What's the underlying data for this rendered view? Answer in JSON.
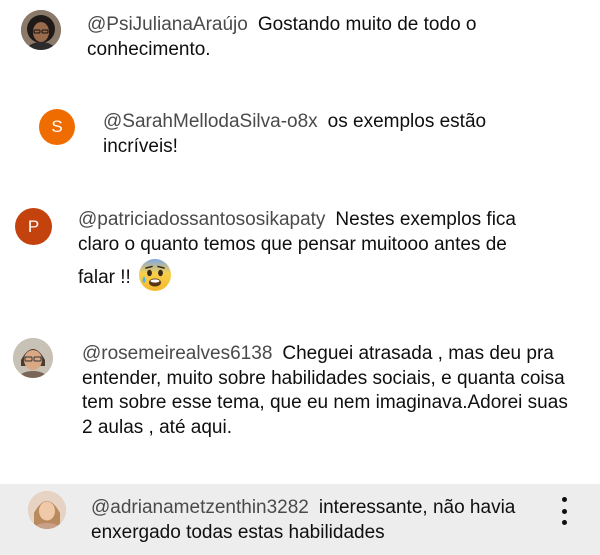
{
  "comments": [
    {
      "handle": "@PsiJulianaAraújo",
      "text": "Gostando muito de todo o conhecimento.",
      "avatar": {
        "type": "photo"
      }
    },
    {
      "handle": "@SarahMellodaSilva-o8x",
      "text": "os exemplos estão incríveis!",
      "avatar": {
        "type": "letter",
        "letter": "S",
        "color": "#ef6c00"
      }
    },
    {
      "handle": "@patriciadossantososikapaty",
      "text": "Nestes exemplos fica claro o quanto temos que pensar muitooo antes de falar !!",
      "emoji": "anxious-face-with-sweat",
      "avatar": {
        "type": "letter",
        "letter": "P",
        "color": "#c4420e"
      }
    },
    {
      "handle": "@rosemeirealves6138",
      "text": "Cheguei atrasada , mas deu pra entender, muito sobre habilidades sociais, e quanta coisa tem sobre esse tema, que eu nem imaginava.Adorei suas 2 aulas , até aqui.",
      "avatar": {
        "type": "photo"
      }
    },
    {
      "handle": "@adrianametzenthin3282",
      "text": "interessante, não havia enxergado todas estas habilidades",
      "avatar": {
        "type": "photo"
      },
      "highlighted": true,
      "menu_icon": "more-vert-icon"
    }
  ],
  "colors": {
    "handle": "#4a4a4a",
    "text": "#0f0f0f",
    "highlight_bg": "#ededed"
  }
}
